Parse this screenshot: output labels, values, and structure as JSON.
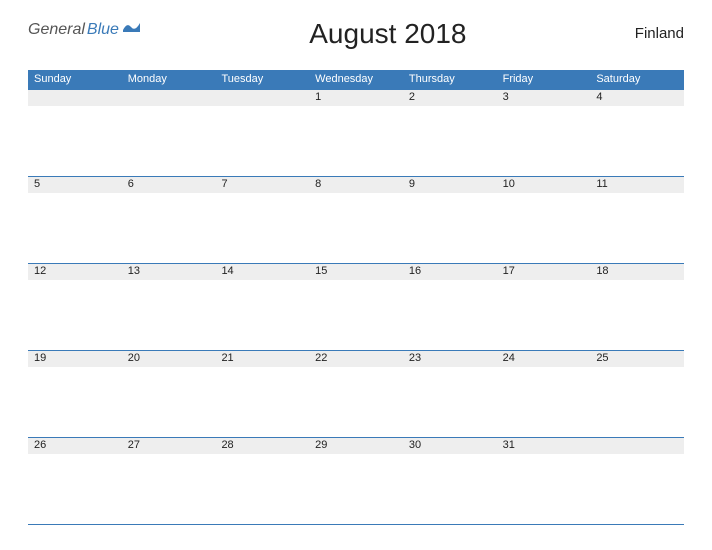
{
  "logo": {
    "general": "General",
    "blue": "Blue"
  },
  "title": "August 2018",
  "country": "Finland",
  "dayHeaders": [
    "Sunday",
    "Monday",
    "Tuesday",
    "Wednesday",
    "Thursday",
    "Friday",
    "Saturday"
  ],
  "weeks": [
    [
      "",
      "",
      "",
      "1",
      "2",
      "3",
      "4"
    ],
    [
      "5",
      "6",
      "7",
      "8",
      "9",
      "10",
      "11"
    ],
    [
      "12",
      "13",
      "14",
      "15",
      "16",
      "17",
      "18"
    ],
    [
      "19",
      "20",
      "21",
      "22",
      "23",
      "24",
      "25"
    ],
    [
      "26",
      "27",
      "28",
      "29",
      "30",
      "31",
      ""
    ]
  ]
}
